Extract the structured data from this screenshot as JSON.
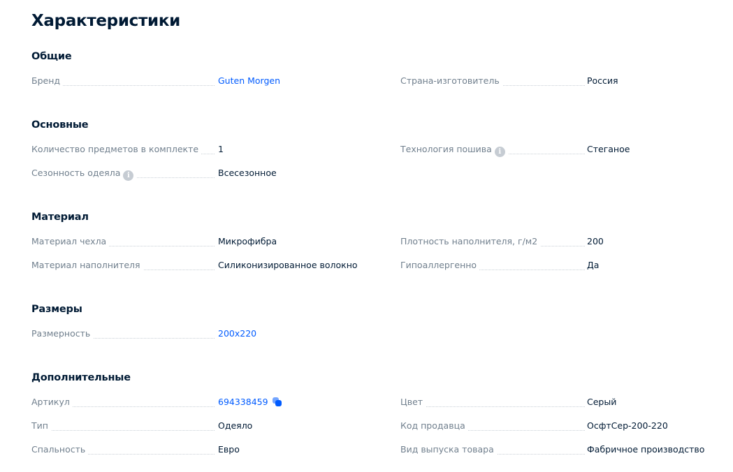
{
  "title": "Характеристики",
  "sections": [
    {
      "title": "Общие",
      "rows": [
        {
          "left": {
            "label": "Бренд",
            "value": "Guten Morgen",
            "link": true
          },
          "right": {
            "label": "Страна-изготовитель",
            "value": "Россия"
          }
        }
      ]
    },
    {
      "title": "Основные",
      "rows": [
        {
          "left": {
            "label": "Количество предметов в комплекте",
            "value": "1"
          },
          "right": {
            "label": "Технология пошива",
            "value": "Стеганое",
            "info_icon": "info-icon"
          }
        },
        {
          "left": {
            "label": "Сезонность одеяла",
            "value": "Всесезонное",
            "info_icon": "info-icon"
          }
        }
      ]
    },
    {
      "title": "Материал",
      "rows": [
        {
          "left": {
            "label": "Материал чехла",
            "value": "Микрофибра"
          },
          "right": {
            "label": "Плотность наполнителя, г/м2",
            "value": "200"
          }
        },
        {
          "left": {
            "label": "Материал наполнителя",
            "value": "Силиконизированное волокно"
          },
          "right": {
            "label": "Гипоаллергенно",
            "value": "Да"
          }
        }
      ]
    },
    {
      "title": "Размеры",
      "rows": [
        {
          "left": {
            "label": "Размерность",
            "value": "200x220",
            "link": true
          }
        }
      ]
    },
    {
      "title": "Дополнительные",
      "rows": [
        {
          "left": {
            "label": "Артикул",
            "value": "694338459",
            "link": true,
            "copy_icon": "copy-icon"
          },
          "right": {
            "label": "Цвет",
            "value": "Серый"
          }
        },
        {
          "left": {
            "label": "Тип",
            "value": "Одеяло"
          },
          "right": {
            "label": "Код продавца",
            "value": "ОсфтСер-200-220"
          }
        },
        {
          "left": {
            "label": "Спальность",
            "value": "Евро"
          },
          "right": {
            "label": "Вид выпуска товара",
            "value": "Фабричное производство"
          }
        }
      ]
    }
  ],
  "colors": {
    "text": "#001a34",
    "label": "#707f8d",
    "link": "#005bff",
    "dots": "#c8cfd6",
    "info": "#c6ccd3"
  }
}
